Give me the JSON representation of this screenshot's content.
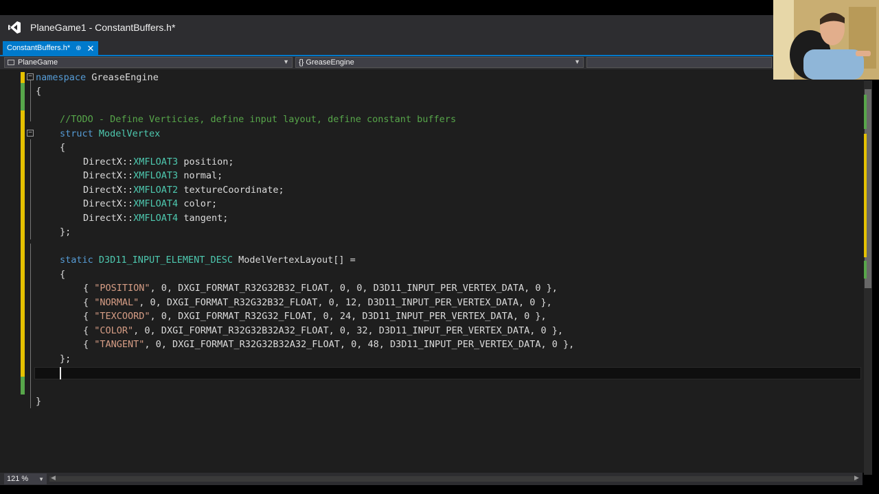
{
  "window": {
    "title": "PlaneGame1 - ConstantBuffers.h*"
  },
  "tab": {
    "label": "ConstantBuffers.h*",
    "pin_icon": "pin-icon",
    "close_icon": "close-icon"
  },
  "navbar": {
    "project": "PlaneGame",
    "scope": "{} GreaseEngine"
  },
  "editor": {
    "lines": [
      {
        "parts": [
          [
            "kw",
            "namespace"
          ],
          [
            "",
            "GreaseEngine"
          ]
        ]
      },
      {
        "parts": [
          [
            "",
            "{"
          ]
        ]
      },
      {
        "parts": []
      },
      {
        "parts": [
          [
            "cm",
            "//TODO - Define Verticies, define input layout, define constant buffers"
          ]
        ]
      },
      {
        "parts": [
          [
            "kw",
            "struct"
          ],
          [
            "ty",
            "ModelVertex"
          ]
        ]
      },
      {
        "parts": [
          [
            "",
            "{"
          ]
        ]
      },
      {
        "parts": [
          [
            "",
            "DirectX::"
          ],
          [
            "ty",
            "XMFLOAT3"
          ],
          [
            "",
            " position;"
          ]
        ]
      },
      {
        "parts": [
          [
            "",
            "DirectX::"
          ],
          [
            "ty",
            "XMFLOAT3"
          ],
          [
            "",
            " normal;"
          ]
        ]
      },
      {
        "parts": [
          [
            "",
            "DirectX::"
          ],
          [
            "ty",
            "XMFLOAT2"
          ],
          [
            "",
            " textureCoordinate;"
          ]
        ]
      },
      {
        "parts": [
          [
            "",
            "DirectX::"
          ],
          [
            "ty",
            "XMFLOAT4"
          ],
          [
            "",
            " color;"
          ]
        ]
      },
      {
        "parts": [
          [
            "",
            "DirectX::"
          ],
          [
            "ty",
            "XMFLOAT4"
          ],
          [
            "",
            " tangent;"
          ]
        ]
      },
      {
        "parts": [
          [
            "",
            "};"
          ]
        ]
      },
      {
        "parts": []
      },
      {
        "parts": [
          [
            "kw",
            "static"
          ],
          [
            "ty",
            "D3D11_INPUT_ELEMENT_DESC"
          ],
          [
            "",
            "ModelVertexLayout[] ="
          ]
        ]
      },
      {
        "parts": [
          [
            "",
            "{"
          ]
        ]
      },
      {
        "parts": [
          [
            "",
            "{ "
          ],
          [
            "str",
            "\"POSITION\""
          ],
          [
            "",
            ", 0, DXGI_FORMAT_R32G32B32_FLOAT, 0, 0, D3D11_INPUT_PER_VERTEX_DATA, 0 },"
          ]
        ]
      },
      {
        "parts": [
          [
            "",
            "{ "
          ],
          [
            "str",
            "\"NORMAL\""
          ],
          [
            "",
            ", 0, DXGI_FORMAT_R32G32B32_FLOAT, 0, 12, D3D11_INPUT_PER_VERTEX_DATA, 0 },"
          ]
        ]
      },
      {
        "parts": [
          [
            "",
            "{ "
          ],
          [
            "str",
            "\"TEXCOORD\""
          ],
          [
            "",
            ", 0, DXGI_FORMAT_R32G32_FLOAT, 0, 24, D3D11_INPUT_PER_VERTEX_DATA, 0 },"
          ]
        ]
      },
      {
        "parts": [
          [
            "",
            "{ "
          ],
          [
            "str",
            "\"COLOR\""
          ],
          [
            "",
            ", 0, DXGI_FORMAT_R32G32B32A32_FLOAT, 0, 32, D3D11_INPUT_PER_VERTEX_DATA, 0 },"
          ]
        ]
      },
      {
        "parts": [
          [
            "",
            "{ "
          ],
          [
            "str",
            "\"TANGENT\""
          ],
          [
            "",
            ", 0, DXGI_FORMAT_R32G32B32A32_FLOAT, 0, 48, D3D11_INPUT_PER_VERTEX_DATA, 0 },"
          ]
        ]
      },
      {
        "parts": [
          [
            "",
            "};"
          ]
        ]
      },
      {
        "parts": []
      },
      {
        "parts": []
      },
      {
        "parts": [
          [
            "",
            "}"
          ]
        ]
      }
    ]
  },
  "statusbar": {
    "zoom": "121 %"
  },
  "colors": {
    "keyword": "#569cd6",
    "type": "#4ec9b0",
    "string": "#d69d85",
    "comment": "#57a64a",
    "text": "#dcdcdc",
    "accent": "#007acc",
    "saved_change": "#57a64a",
    "unsaved_change": "#e5c100"
  }
}
